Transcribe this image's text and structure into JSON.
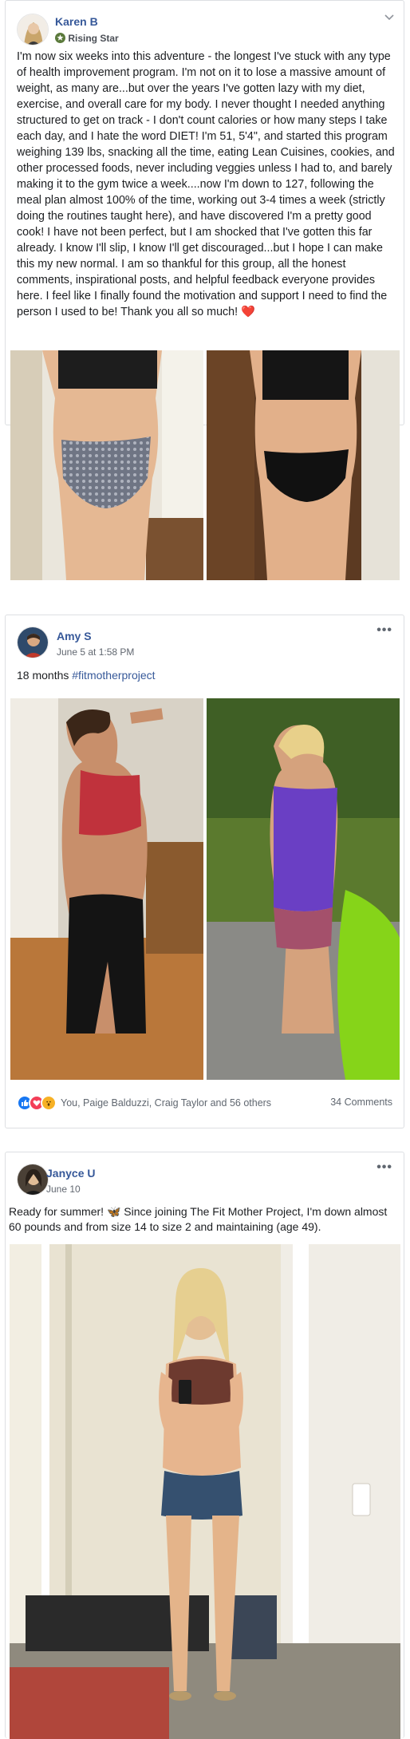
{
  "posts": [
    {
      "author": "Karen B",
      "badge": "Rising Star",
      "text": "I'm now six weeks into this adventure - the longest I've stuck with any type of health improvement program. I'm not on it to lose a massive amount of weight, as many are...but over the years I've gotten lazy with my diet, exercise, and overall care for my body. I never thought I needed anything structured to get on track - I don't count calories or how many steps I take each day, and I hate the word DIET! I'm 51, 5'4\", and started this program weighing 139 lbs, snacking all the time, eating Lean Cuisines, cookies, and other processed foods, never including veggies unless I had to, and barely making it to the gym twice a week....now I'm down to 127, following the meal plan almost 100% of the time, working out 3-4 times a week (strictly doing the routines taught here), and have discovered I'm a pretty good cook! I have not been perfect, but I am shocked that I've gotten this far already. I know I'll slip, I know I'll get discouraged...but I hope I can make this my new normal. I am so thankful for this group, all the honest comments, inspirational posts, and helpful feedback everyone provides here. I feel like I finally found the motivation and support I need to find the person I used to be! Thank you all so much!",
      "emoji": "❤️"
    },
    {
      "author": "Amy S",
      "time": "June 5 at 1:58 PM",
      "text_plain": "18 months ",
      "hashtag": "#fitmotherproject",
      "reactions_text": "You, Paige Balduzzi, Craig Taylor and 56 others",
      "comments": "34 Comments"
    },
    {
      "author": "Janyce U",
      "time": "June 10",
      "text_a": "Ready for summer! ",
      "butterfly": "🦋",
      "text_b": " Since joining The Fit Mother Project, I'm down almost 60 pounds and from size 14 to size 2 and maintaining (age 49)."
    }
  ],
  "icons": {
    "star": "star-icon",
    "dropdown": "chevron-down-icon",
    "more": "more-options-icon",
    "like": "like-reaction-icon",
    "love": "love-reaction-icon",
    "wow": "wow-reaction-icon"
  },
  "colors": {
    "link": "#365899",
    "meta": "#616770",
    "like": "#1877f2",
    "love": "#f33e58",
    "wow": "#f7b125"
  }
}
